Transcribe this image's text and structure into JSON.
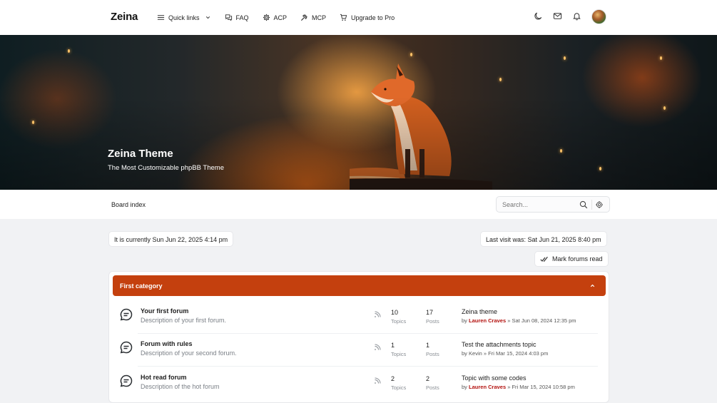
{
  "brand": {
    "logo": "Zeina"
  },
  "nav": {
    "items": [
      {
        "label": "Quick links",
        "icon": "hamburger-icon",
        "has_caret": true
      },
      {
        "label": "FAQ",
        "icon": "chat-bubbles-icon"
      },
      {
        "label": "ACP",
        "icon": "gear-icon"
      },
      {
        "label": "MCP",
        "icon": "gavel-icon"
      },
      {
        "label": "Upgrade to Pro",
        "icon": "cart-icon"
      }
    ],
    "right_icons": [
      "moon-icon",
      "mail-icon",
      "bell-icon",
      "avatar"
    ]
  },
  "hero": {
    "title": "Zeina Theme",
    "subtitle": "The Most Customizable phpBB Theme"
  },
  "breadcrumb": {
    "label": "Board index"
  },
  "search": {
    "placeholder": "Search..."
  },
  "info": {
    "current_time": "It is currently Sun Jun 22, 2025 4:14 pm",
    "last_visit": "Last visit was: Sat Jun 21, 2025 8:40 pm",
    "mark_read": "Mark forums read"
  },
  "category": {
    "title": "First category",
    "accent_color": "#c4400e",
    "forums": [
      {
        "title": "Your first forum",
        "description": "Description of your first forum.",
        "topics": "10",
        "topics_label": "Topics",
        "posts": "17",
        "posts_label": "Posts",
        "last_title": "Zeina theme",
        "by": "by",
        "last_user": "Lauren Craves",
        "user_highlight": true,
        "last_date": "» Sat Jun 08, 2024 12:35 pm"
      },
      {
        "title": "Forum with rules",
        "description": "Description of your second forum.",
        "topics": "1",
        "topics_label": "Topics",
        "posts": "1",
        "posts_label": "Posts",
        "last_title": "Test the attachments topic",
        "by": "by",
        "last_user": "Kevin",
        "user_highlight": false,
        "last_date": "» Fri Mar 15, 2024 4:03 pm"
      },
      {
        "title": "Hot read forum",
        "description": "Description of the hot forum",
        "topics": "2",
        "topics_label": "Topics",
        "posts": "2",
        "posts_label": "Posts",
        "last_title": "Topic with some codes",
        "by": "by",
        "last_user": "Lauren Craves",
        "user_highlight": true,
        "last_date": "» Fri Mar 15, 2024 10:58 pm"
      }
    ]
  }
}
